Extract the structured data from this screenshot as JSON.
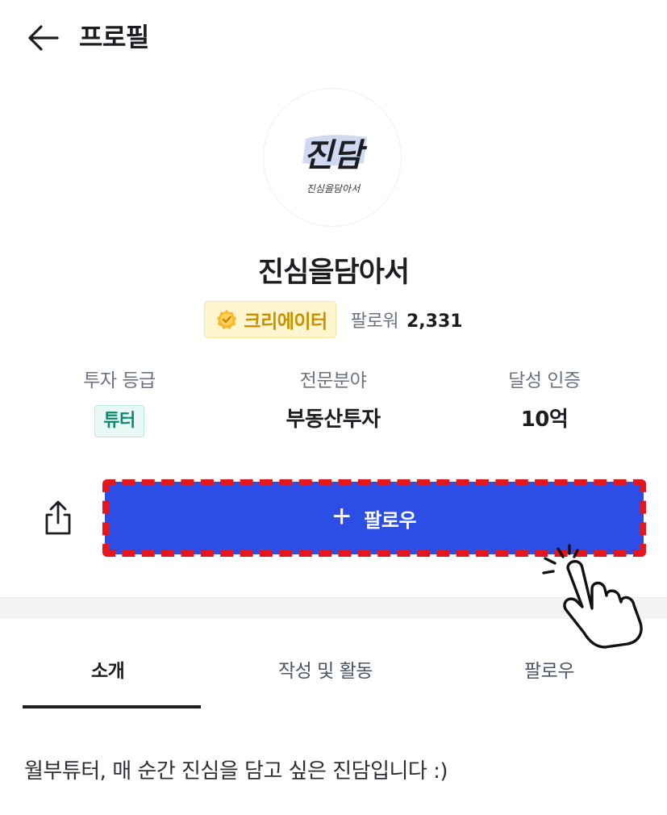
{
  "header": {
    "title": "프로필"
  },
  "profile": {
    "avatar_text": "진담",
    "avatar_subtext": "진심을담아서",
    "nickname": "진심을담아서",
    "creator_badge": "크리에이터",
    "followers_label": "팔로워",
    "followers_count": "2,331"
  },
  "stats": [
    {
      "label": "투자 등급",
      "value": "튜터"
    },
    {
      "label": "전문분야",
      "value": "부동산투자"
    },
    {
      "label": "달성 인증",
      "value": "10억"
    }
  ],
  "actions": {
    "plus": "+",
    "follow_label": "팔로우"
  },
  "tabs": [
    {
      "label": "소개",
      "active": true
    },
    {
      "label": "작성 및 활동",
      "active": false
    },
    {
      "label": "팔로우",
      "active": false
    }
  ],
  "intro_text": "월부튜터, 매 순간 진심을 담고 싶은 진담입니다 :)",
  "colors": {
    "primary": "#2c4ee6",
    "highlight": "#e5161b",
    "creator_badge": "#c99100",
    "grade_badge": "#0a8a70"
  },
  "icons": {
    "back": "arrow-left-icon",
    "creator": "verified-badge-icon",
    "share": "share-icon",
    "pointer": "pointer-hand-icon"
  }
}
